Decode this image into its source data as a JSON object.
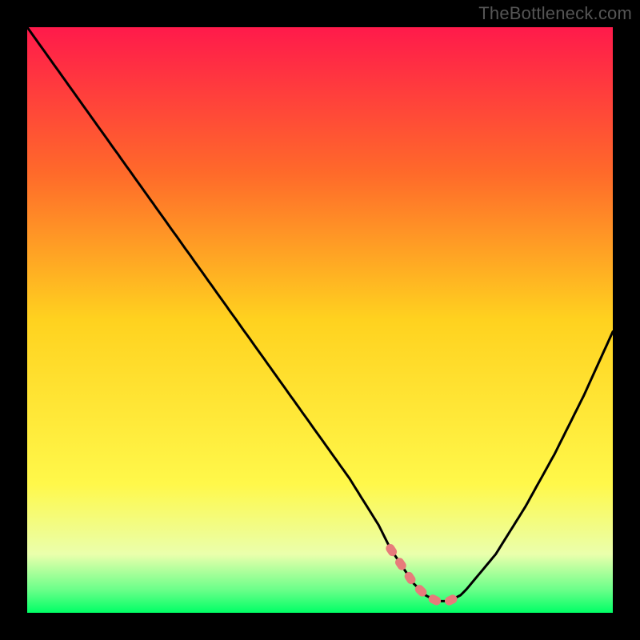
{
  "attribution": "TheBottleneck.com",
  "chart_data": {
    "type": "line",
    "title": "",
    "xlabel": "",
    "ylabel": "",
    "xlim": [
      0,
      100
    ],
    "ylim": [
      0,
      100
    ],
    "x": [
      0,
      5,
      10,
      15,
      20,
      25,
      30,
      35,
      40,
      45,
      50,
      55,
      60,
      62,
      64,
      66,
      68,
      70,
      72,
      74,
      75,
      80,
      85,
      90,
      95,
      100
    ],
    "values": [
      100,
      93,
      86,
      79,
      72,
      65,
      58,
      51,
      44,
      37,
      30,
      23,
      15,
      11,
      8,
      5,
      3,
      2,
      2,
      3,
      4,
      10,
      18,
      27,
      37,
      48
    ],
    "highlight_region": {
      "x_start": 62,
      "x_end": 74
    },
    "gradient_stops": [
      {
        "offset": 0.0,
        "color": "#ff1a4b"
      },
      {
        "offset": 0.25,
        "color": "#ff6a2a"
      },
      {
        "offset": 0.5,
        "color": "#ffd21f"
      },
      {
        "offset": 0.78,
        "color": "#fff84a"
      },
      {
        "offset": 0.9,
        "color": "#eaffac"
      },
      {
        "offset": 0.96,
        "color": "#6cff8a"
      },
      {
        "offset": 1.0,
        "color": "#00ff66"
      }
    ]
  }
}
